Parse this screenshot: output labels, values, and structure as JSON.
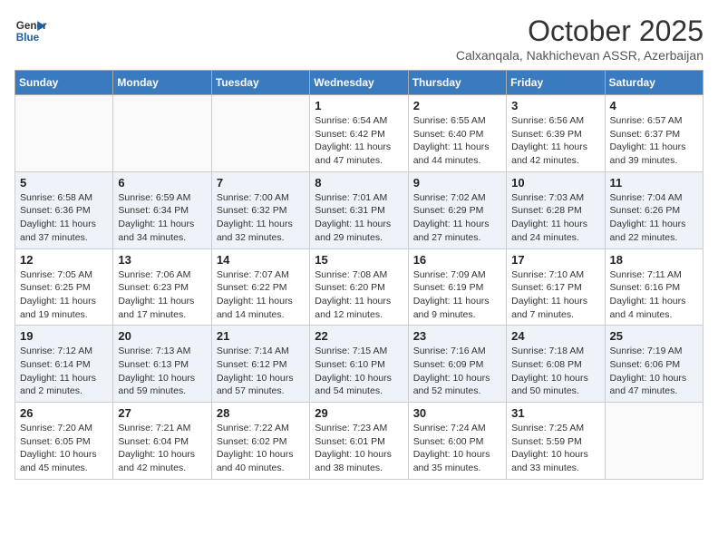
{
  "header": {
    "logo_line1": "General",
    "logo_line2": "Blue",
    "month_title": "October 2025",
    "subtitle": "Calxanqala, Nakhichevan ASSR, Azerbaijan"
  },
  "days_of_week": [
    "Sunday",
    "Monday",
    "Tuesday",
    "Wednesday",
    "Thursday",
    "Friday",
    "Saturday"
  ],
  "weeks": [
    [
      {
        "day": "",
        "info": ""
      },
      {
        "day": "",
        "info": ""
      },
      {
        "day": "",
        "info": ""
      },
      {
        "day": "1",
        "info": "Sunrise: 6:54 AM\nSunset: 6:42 PM\nDaylight: 11 hours\nand 47 minutes."
      },
      {
        "day": "2",
        "info": "Sunrise: 6:55 AM\nSunset: 6:40 PM\nDaylight: 11 hours\nand 44 minutes."
      },
      {
        "day": "3",
        "info": "Sunrise: 6:56 AM\nSunset: 6:39 PM\nDaylight: 11 hours\nand 42 minutes."
      },
      {
        "day": "4",
        "info": "Sunrise: 6:57 AM\nSunset: 6:37 PM\nDaylight: 11 hours\nand 39 minutes."
      }
    ],
    [
      {
        "day": "5",
        "info": "Sunrise: 6:58 AM\nSunset: 6:36 PM\nDaylight: 11 hours\nand 37 minutes."
      },
      {
        "day": "6",
        "info": "Sunrise: 6:59 AM\nSunset: 6:34 PM\nDaylight: 11 hours\nand 34 minutes."
      },
      {
        "day": "7",
        "info": "Sunrise: 7:00 AM\nSunset: 6:32 PM\nDaylight: 11 hours\nand 32 minutes."
      },
      {
        "day": "8",
        "info": "Sunrise: 7:01 AM\nSunset: 6:31 PM\nDaylight: 11 hours\nand 29 minutes."
      },
      {
        "day": "9",
        "info": "Sunrise: 7:02 AM\nSunset: 6:29 PM\nDaylight: 11 hours\nand 27 minutes."
      },
      {
        "day": "10",
        "info": "Sunrise: 7:03 AM\nSunset: 6:28 PM\nDaylight: 11 hours\nand 24 minutes."
      },
      {
        "day": "11",
        "info": "Sunrise: 7:04 AM\nSunset: 6:26 PM\nDaylight: 11 hours\nand 22 minutes."
      }
    ],
    [
      {
        "day": "12",
        "info": "Sunrise: 7:05 AM\nSunset: 6:25 PM\nDaylight: 11 hours\nand 19 minutes."
      },
      {
        "day": "13",
        "info": "Sunrise: 7:06 AM\nSunset: 6:23 PM\nDaylight: 11 hours\nand 17 minutes."
      },
      {
        "day": "14",
        "info": "Sunrise: 7:07 AM\nSunset: 6:22 PM\nDaylight: 11 hours\nand 14 minutes."
      },
      {
        "day": "15",
        "info": "Sunrise: 7:08 AM\nSunset: 6:20 PM\nDaylight: 11 hours\nand 12 minutes."
      },
      {
        "day": "16",
        "info": "Sunrise: 7:09 AM\nSunset: 6:19 PM\nDaylight: 11 hours\nand 9 minutes."
      },
      {
        "day": "17",
        "info": "Sunrise: 7:10 AM\nSunset: 6:17 PM\nDaylight: 11 hours\nand 7 minutes."
      },
      {
        "day": "18",
        "info": "Sunrise: 7:11 AM\nSunset: 6:16 PM\nDaylight: 11 hours\nand 4 minutes."
      }
    ],
    [
      {
        "day": "19",
        "info": "Sunrise: 7:12 AM\nSunset: 6:14 PM\nDaylight: 11 hours\nand 2 minutes."
      },
      {
        "day": "20",
        "info": "Sunrise: 7:13 AM\nSunset: 6:13 PM\nDaylight: 10 hours\nand 59 minutes."
      },
      {
        "day": "21",
        "info": "Sunrise: 7:14 AM\nSunset: 6:12 PM\nDaylight: 10 hours\nand 57 minutes."
      },
      {
        "day": "22",
        "info": "Sunrise: 7:15 AM\nSunset: 6:10 PM\nDaylight: 10 hours\nand 54 minutes."
      },
      {
        "day": "23",
        "info": "Sunrise: 7:16 AM\nSunset: 6:09 PM\nDaylight: 10 hours\nand 52 minutes."
      },
      {
        "day": "24",
        "info": "Sunrise: 7:18 AM\nSunset: 6:08 PM\nDaylight: 10 hours\nand 50 minutes."
      },
      {
        "day": "25",
        "info": "Sunrise: 7:19 AM\nSunset: 6:06 PM\nDaylight: 10 hours\nand 47 minutes."
      }
    ],
    [
      {
        "day": "26",
        "info": "Sunrise: 7:20 AM\nSunset: 6:05 PM\nDaylight: 10 hours\nand 45 minutes."
      },
      {
        "day": "27",
        "info": "Sunrise: 7:21 AM\nSunset: 6:04 PM\nDaylight: 10 hours\nand 42 minutes."
      },
      {
        "day": "28",
        "info": "Sunrise: 7:22 AM\nSunset: 6:02 PM\nDaylight: 10 hours\nand 40 minutes."
      },
      {
        "day": "29",
        "info": "Sunrise: 7:23 AM\nSunset: 6:01 PM\nDaylight: 10 hours\nand 38 minutes."
      },
      {
        "day": "30",
        "info": "Sunrise: 7:24 AM\nSunset: 6:00 PM\nDaylight: 10 hours\nand 35 minutes."
      },
      {
        "day": "31",
        "info": "Sunrise: 7:25 AM\nSunset: 5:59 PM\nDaylight: 10 hours\nand 33 minutes."
      },
      {
        "day": "",
        "info": ""
      }
    ]
  ]
}
